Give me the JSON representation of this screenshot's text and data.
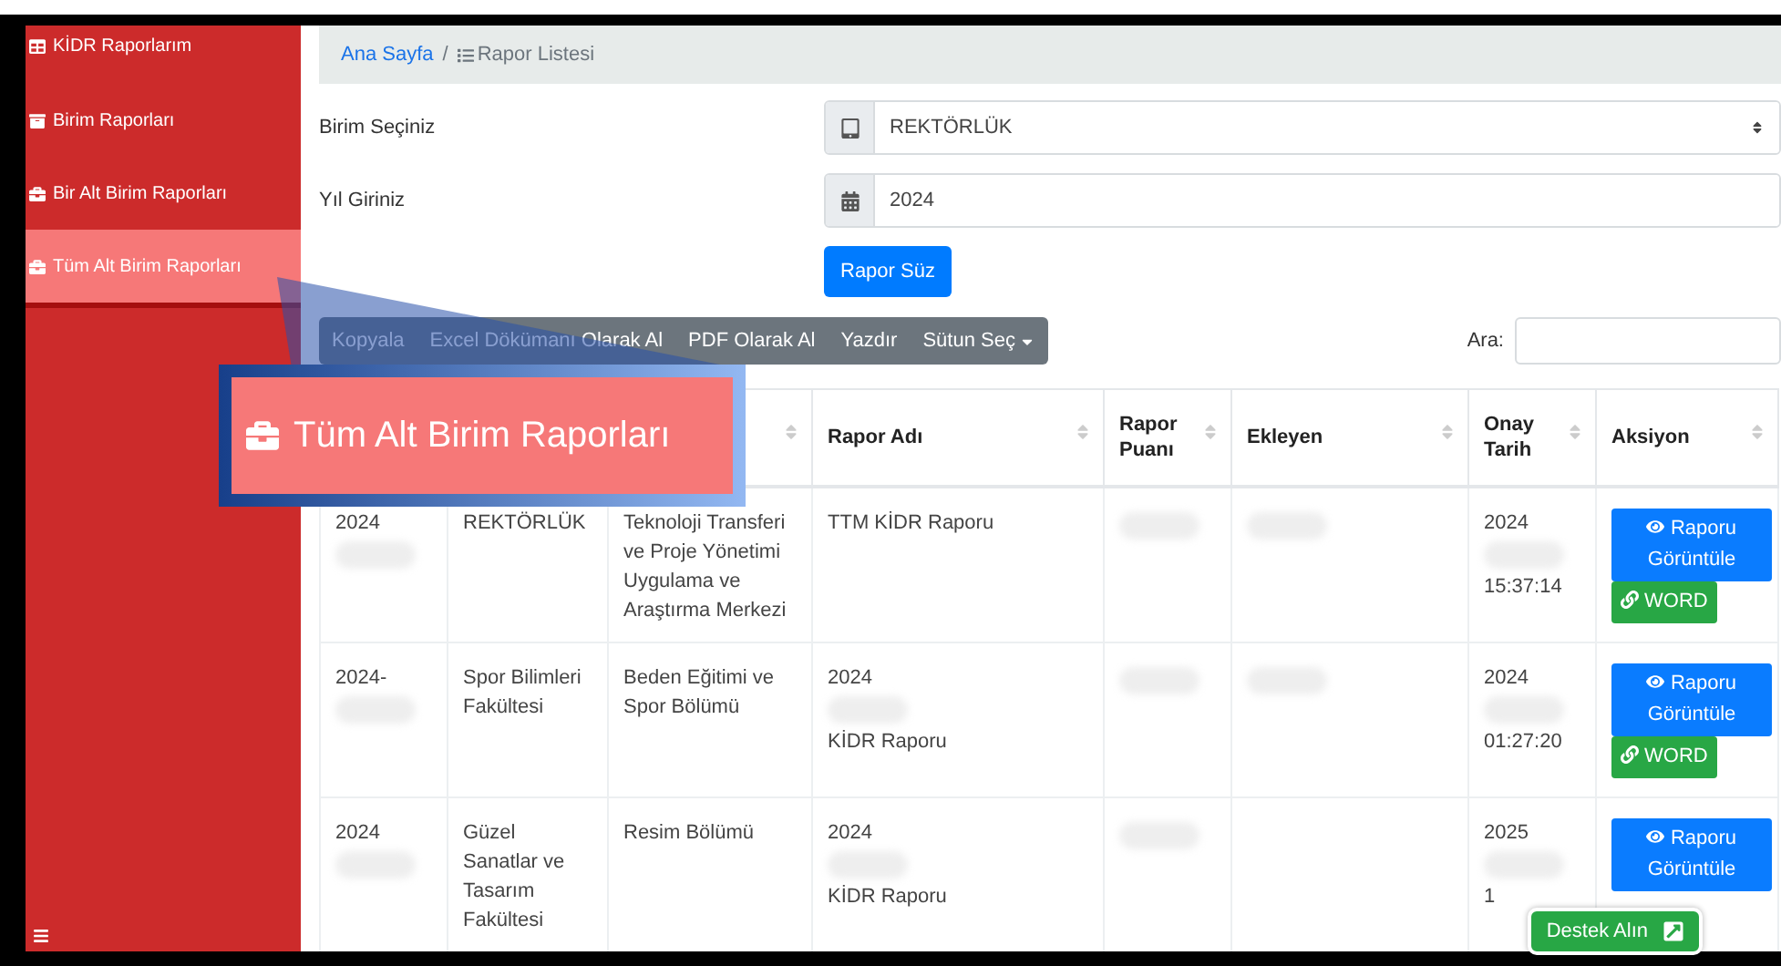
{
  "sidebar": {
    "items": [
      {
        "label": "KİDR Raporlarım",
        "selected": false
      },
      {
        "label": "Birim Raporları",
        "selected": false
      },
      {
        "label": "Bir Alt Birim Raporları",
        "selected": false
      },
      {
        "label": "Tüm Alt Birim Raporları",
        "selected": true
      }
    ]
  },
  "breadcrumb": [
    {
      "label": "Ana Sayfa",
      "kind": "link"
    },
    {
      "label": "/",
      "kind": "separator"
    },
    {
      "label": "Rapor Listesi",
      "kind": "current"
    }
  ],
  "filters": [
    {
      "label": "Birim Seçiniz",
      "kind": "select",
      "value": "REKTÖRLÜK"
    },
    {
      "label": "Yıl Giriniz",
      "kind": "date",
      "value": "2024"
    }
  ],
  "filter_button": "Rapor Süz",
  "export_buttons": [
    {
      "label": "Kopyala",
      "dropdown": false
    },
    {
      "label": "Excel Dökümanı Olarak Al",
      "dropdown": false
    },
    {
      "label": "PDF Olarak Al",
      "dropdown": false
    },
    {
      "label": "Yazdır",
      "dropdown": false
    },
    {
      "label": "Sütun Seç",
      "dropdown": true
    }
  ],
  "search_label": "Ara:",
  "table": {
    "columns": [
      "",
      "",
      "",
      "Rapor Adı",
      "Rapor Puanı",
      "Ekleyen",
      "Onay Tarih",
      "Aksiyon"
    ],
    "rows": [
      {
        "cells": [
          {
            "parts": [
              "2024"
            ],
            "redacted": true
          },
          {
            "parts": [
              "REKTÖRLÜK"
            ],
            "redacted": false
          },
          {
            "parts": [
              "Teknoloji Transferi ve Proje Yönetimi Uygulama ve Araştırma Merkezi"
            ],
            "redacted": false
          },
          {
            "parts": [
              "TTM KİDR Raporu"
            ],
            "redacted": false
          },
          {
            "redacted": true
          },
          {
            "redacted": true
          },
          {
            "parts": [
              "2024",
              "15:37:14"
            ],
            "redacted": true
          }
        ],
        "actions": [
          {
            "label": "Raporu Görüntüle",
            "kind": "view"
          },
          {
            "label": "WORD",
            "kind": "word"
          }
        ]
      },
      {
        "cells": [
          {
            "parts": [
              "2024-"
            ],
            "redacted": true
          },
          {
            "parts": [
              "Spor Bilimleri Fakültesi"
            ],
            "redacted": false
          },
          {
            "parts": [
              "Beden Eğitimi ve Spor Bölümü"
            ],
            "redacted": false
          },
          {
            "parts": [
              "2024",
              "KİDR Raporu"
            ],
            "redacted": true
          },
          {
            "redacted": true
          },
          {
            "redacted": true
          },
          {
            "parts": [
              "2024",
              "01:27:20"
            ],
            "redacted": true
          }
        ],
        "actions": [
          {
            "label": "Raporu Görüntüle",
            "kind": "view"
          },
          {
            "label": "WORD",
            "kind": "word"
          }
        ]
      },
      {
        "cells": [
          {
            "parts": [
              "2024"
            ],
            "redacted": true
          },
          {
            "parts": [
              "Güzel Sanatlar ve Tasarım Fakültesi"
            ],
            "redacted": false
          },
          {
            "parts": [
              "Resim Bölümü"
            ],
            "redacted": false
          },
          {
            "parts": [
              "2024",
              "KİDR Raporu"
            ],
            "redacted": true
          },
          {
            "redacted": true
          },
          {
            "redacted": false
          },
          {
            "parts": [
              "2025",
              "1"
            ],
            "redacted": true
          }
        ],
        "actions": [
          {
            "label": "Raporu Görüntüle",
            "kind": "view"
          }
        ]
      }
    ]
  },
  "support_button": "Destek Alın",
  "callout": {
    "label": "Tüm Alt Birim Raporları"
  }
}
